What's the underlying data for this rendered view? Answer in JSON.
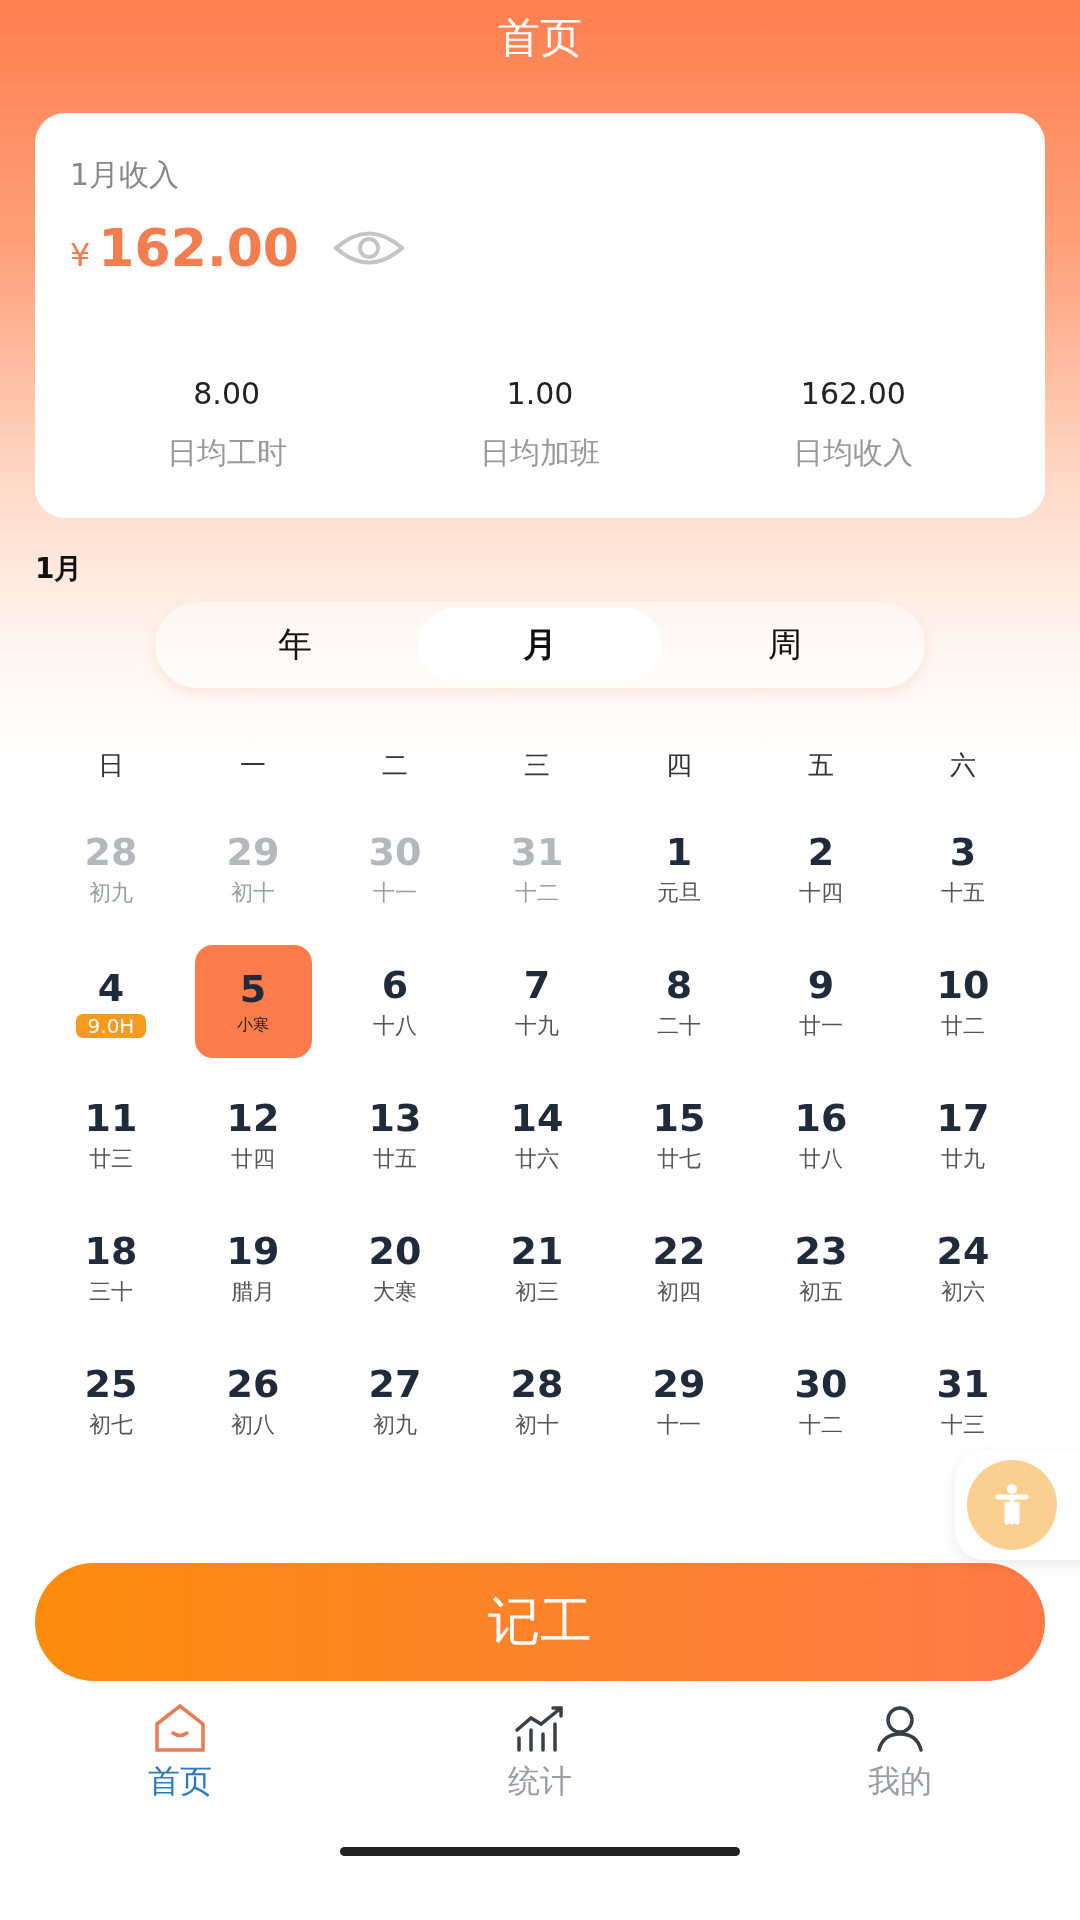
{
  "header": {
    "title": "首页"
  },
  "summary": {
    "label": "1月收入",
    "currency": "¥",
    "amount": "162.00",
    "stats": [
      {
        "value": "8.00",
        "label": "日均工时"
      },
      {
        "value": "1.00",
        "label": "日均加班"
      },
      {
        "value": "162.00",
        "label": "日均收入"
      }
    ]
  },
  "month_label": "1月",
  "view_tabs": [
    {
      "label": "年",
      "selected": false
    },
    {
      "label": "月",
      "selected": true
    },
    {
      "label": "周",
      "selected": false
    }
  ],
  "weekdays": [
    "日",
    "一",
    "二",
    "三",
    "四",
    "五",
    "六"
  ],
  "days": [
    {
      "num": "28",
      "sub": "初九",
      "muted": true,
      "selected": false
    },
    {
      "num": "29",
      "sub": "初十",
      "muted": true,
      "selected": false
    },
    {
      "num": "30",
      "sub": "十一",
      "muted": true,
      "selected": false
    },
    {
      "num": "31",
      "sub": "十二",
      "muted": true,
      "selected": false
    },
    {
      "num": "1",
      "sub": "元旦",
      "muted": false,
      "selected": false
    },
    {
      "num": "2",
      "sub": "十四",
      "muted": false,
      "selected": false
    },
    {
      "num": "3",
      "sub": "十五",
      "muted": false,
      "selected": false
    },
    {
      "num": "4",
      "badge": "9.0H",
      "muted": false,
      "selected": false
    },
    {
      "num": "5",
      "sub": "小寒",
      "muted": false,
      "selected": true
    },
    {
      "num": "6",
      "sub": "十八",
      "muted": false,
      "selected": false
    },
    {
      "num": "7",
      "sub": "十九",
      "muted": false,
      "selected": false
    },
    {
      "num": "8",
      "sub": "二十",
      "muted": false,
      "selected": false
    },
    {
      "num": "9",
      "sub": "廿一",
      "muted": false,
      "selected": false
    },
    {
      "num": "10",
      "sub": "廿二",
      "muted": false,
      "selected": false
    },
    {
      "num": "11",
      "sub": "廿三",
      "muted": false,
      "selected": false
    },
    {
      "num": "12",
      "sub": "廿四",
      "muted": false,
      "selected": false
    },
    {
      "num": "13",
      "sub": "廿五",
      "muted": false,
      "selected": false
    },
    {
      "num": "14",
      "sub": "廿六",
      "muted": false,
      "selected": false
    },
    {
      "num": "15",
      "sub": "廿七",
      "muted": false,
      "selected": false
    },
    {
      "num": "16",
      "sub": "廿八",
      "muted": false,
      "selected": false
    },
    {
      "num": "17",
      "sub": "廿九",
      "muted": false,
      "selected": false
    },
    {
      "num": "18",
      "sub": "三十",
      "muted": false,
      "selected": false
    },
    {
      "num": "19",
      "sub": "腊月",
      "muted": false,
      "selected": false
    },
    {
      "num": "20",
      "sub": "大寒",
      "muted": false,
      "selected": false
    },
    {
      "num": "21",
      "sub": "初三",
      "muted": false,
      "selected": false
    },
    {
      "num": "22",
      "sub": "初四",
      "muted": false,
      "selected": false
    },
    {
      "num": "23",
      "sub": "初五",
      "muted": false,
      "selected": false
    },
    {
      "num": "24",
      "sub": "初六",
      "muted": false,
      "selected": false
    },
    {
      "num": "25",
      "sub": "初七",
      "muted": false,
      "selected": false
    },
    {
      "num": "26",
      "sub": "初八",
      "muted": false,
      "selected": false
    },
    {
      "num": "27",
      "sub": "初九",
      "muted": false,
      "selected": false
    },
    {
      "num": "28",
      "sub": "初十",
      "muted": false,
      "selected": false
    },
    {
      "num": "29",
      "sub": "十一",
      "muted": false,
      "selected": false
    },
    {
      "num": "30",
      "sub": "十二",
      "muted": false,
      "selected": false
    },
    {
      "num": "31",
      "sub": "十三",
      "muted": false,
      "selected": false
    }
  ],
  "record_button": "记工",
  "nav": [
    {
      "kind": "home",
      "label": "首页",
      "selected": true
    },
    {
      "kind": "stats",
      "label": "统计",
      "selected": false
    },
    {
      "kind": "profile",
      "label": "我的",
      "selected": false
    }
  ]
}
